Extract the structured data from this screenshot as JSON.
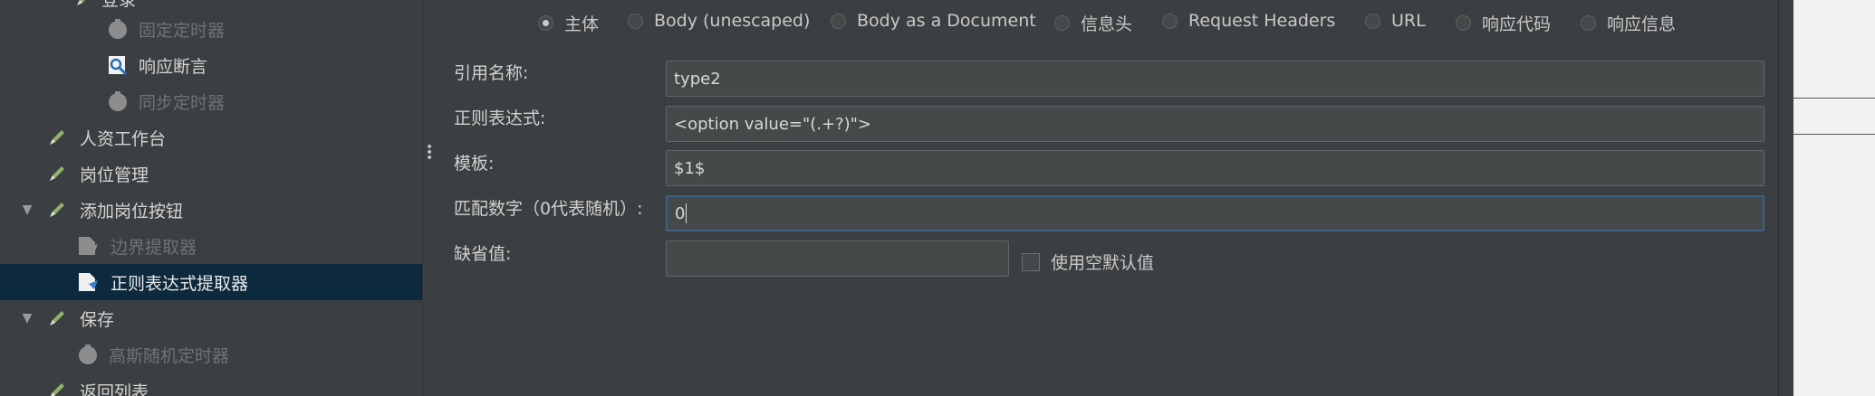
{
  "tree": {
    "items": [
      {
        "label": "登录",
        "icon": "sampler-pencil-icon",
        "state": "normal",
        "arrow": ""
      },
      {
        "label": "固定定时器",
        "icon": "timer-icon",
        "state": "disabled",
        "arrow": ""
      },
      {
        "label": "响应断言",
        "icon": "assertion-icon",
        "state": "normal",
        "arrow": ""
      },
      {
        "label": "同步定时器",
        "icon": "timer-icon",
        "state": "disabled",
        "arrow": ""
      },
      {
        "label": "人资工作台",
        "icon": "sampler-pencil-icon",
        "state": "normal",
        "arrow": ""
      },
      {
        "label": "岗位管理",
        "icon": "sampler-pencil-icon",
        "state": "normal",
        "arrow": ""
      },
      {
        "label": "添加岗位按钮",
        "icon": "sampler-pencil-icon",
        "state": "normal",
        "arrow": "▼"
      },
      {
        "label": "边界提取器",
        "icon": "extractor-icon",
        "state": "disabled",
        "arrow": ""
      },
      {
        "label": "正则表达式提取器",
        "icon": "extractor-icon",
        "state": "selected",
        "arrow": ""
      },
      {
        "label": "保存",
        "icon": "sampler-pencil-icon",
        "state": "normal",
        "arrow": "▼"
      },
      {
        "label": "高斯随机定时器",
        "icon": "timer-icon",
        "state": "disabled",
        "arrow": ""
      },
      {
        "label": "返回列表",
        "icon": "sampler-pencil-icon",
        "state": "normal",
        "arrow": ""
      }
    ]
  },
  "form": {
    "apply_to_options": [
      {
        "label": "主体",
        "checked": true
      },
      {
        "label": "Body (unescaped)",
        "checked": false
      },
      {
        "label": "Body as a Document",
        "checked": false
      },
      {
        "label": "信息头",
        "checked": false
      },
      {
        "label": "Request Headers",
        "checked": false
      },
      {
        "label": "URL",
        "checked": false
      },
      {
        "label": "响应代码",
        "checked": false
      },
      {
        "label": "响应信息",
        "checked": false
      }
    ],
    "reference_name": {
      "label": "引用名称:",
      "value": "type2"
    },
    "regex": {
      "label": "正则表达式:",
      "value": "<option value=\"(.+?)\">"
    },
    "template": {
      "label": "模板:",
      "value": "$1$"
    },
    "match_no": {
      "label": "匹配数字（0代表随机）:",
      "value": "0"
    },
    "default_value": {
      "label": "缺省值:",
      "value": ""
    },
    "use_empty_default": {
      "label": "使用空默认值",
      "checked": false
    }
  },
  "colors": {
    "background": "#3c3f41",
    "selected_row": "#0d293e",
    "field_bg": "#45494a",
    "focus_border": "#3d6185"
  }
}
